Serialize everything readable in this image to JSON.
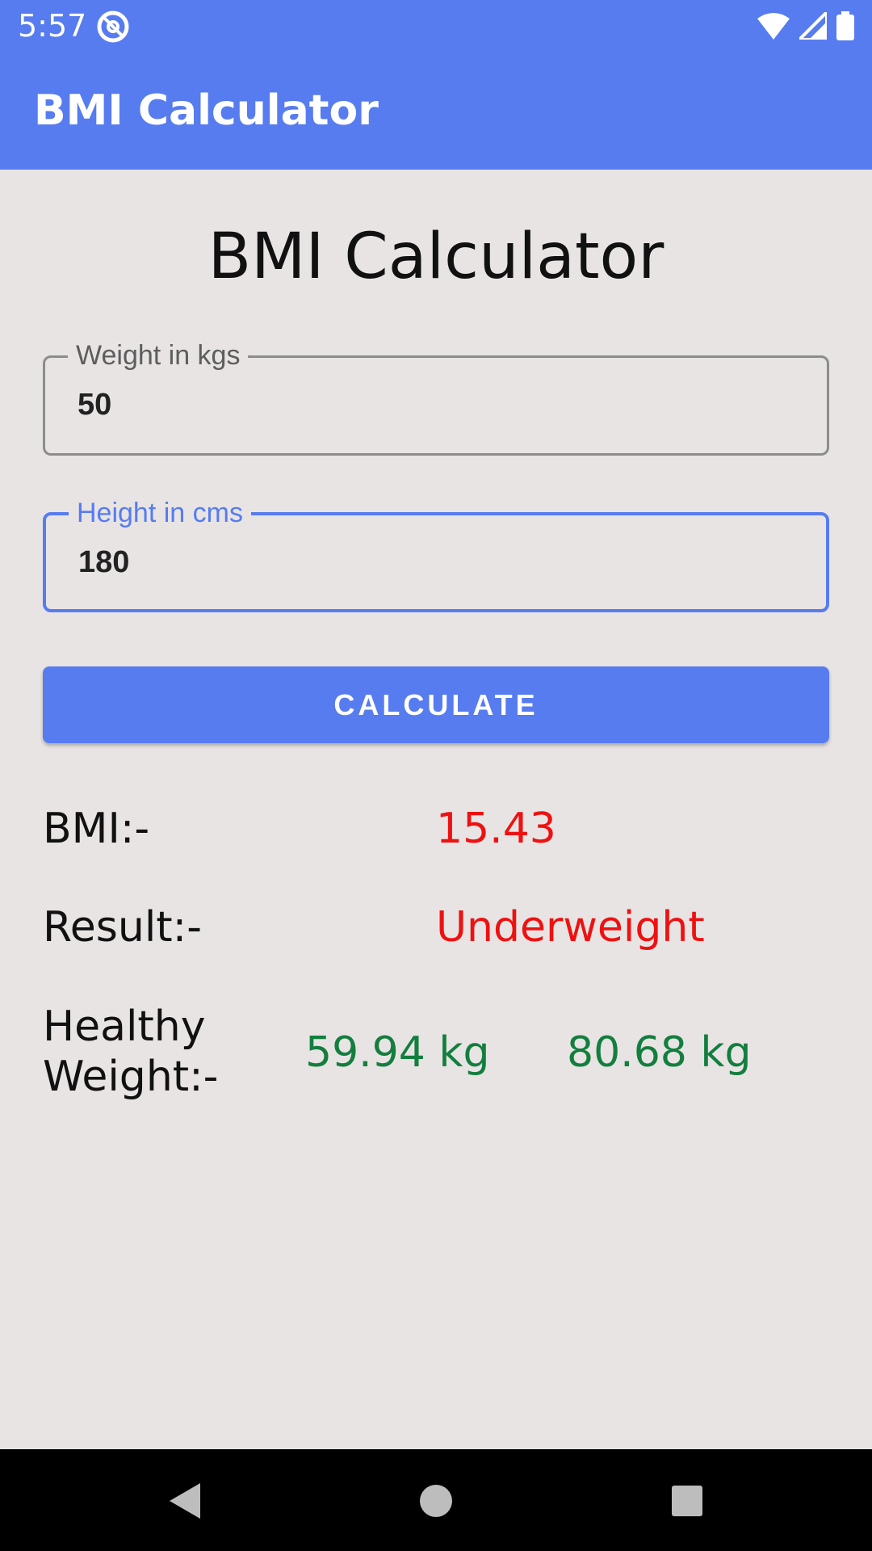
{
  "status_bar": {
    "time": "5:57",
    "app_icon": "at-sign-icon",
    "icons": [
      "wifi-icon",
      "cell-signal-icon",
      "battery-icon"
    ]
  },
  "app_bar": {
    "title": "BMI Calculator"
  },
  "main": {
    "heading": "BMI Calculator",
    "weight_field": {
      "label": "Weight in kgs",
      "value": "50"
    },
    "height_field": {
      "label": "Height in cms",
      "value": "180"
    },
    "calculate_label": "CALCULATE",
    "bmi": {
      "label": "BMI:-",
      "value": "15.43"
    },
    "result": {
      "label": "Result:-",
      "value": "Underweight"
    },
    "healthy_weight": {
      "label_line1": "Healthy",
      "label_line2": "Weight:-",
      "min": "59.94 kg",
      "max": "80.68 kg"
    }
  },
  "colors": {
    "accent": "#577cef",
    "alert": "#ee1111",
    "healthy": "#137e3e",
    "background": "#e8e4e4"
  },
  "nav_bar": {
    "icons": [
      "back-icon",
      "home-icon",
      "recents-icon"
    ]
  }
}
